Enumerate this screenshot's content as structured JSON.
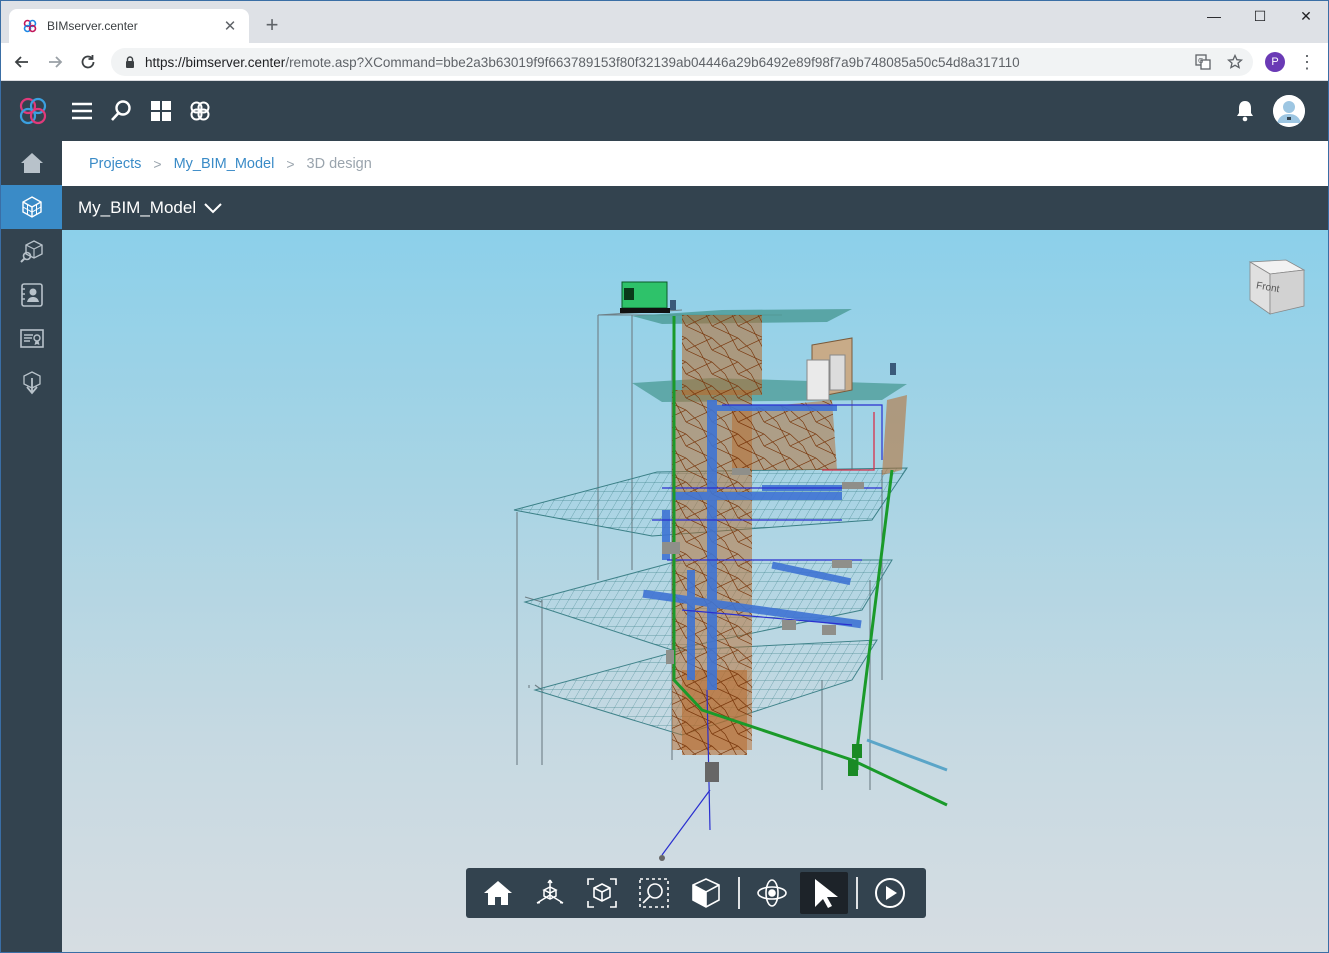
{
  "browser": {
    "tab_title": "BIMserver.center",
    "tab_close": "✕",
    "new_tab": "+",
    "url_host": "https://bimserver.center",
    "url_path": "/remote.asp?XCommand=bbe2a3b63019f9f663789153f80f32139ab04446a29b6492e89f98f7a9b748085a50c54d8a317110",
    "profile_initial": "P",
    "minimize": "—",
    "maximize": "☐",
    "close": "✕"
  },
  "header": {
    "icons": [
      "menu-icon",
      "search-icon",
      "grid-icon",
      "bimserver-icon"
    ],
    "right_icons": [
      "bell-icon",
      "avatar"
    ]
  },
  "sidebar": {
    "items": [
      {
        "icon": "home-icon",
        "active": false
      },
      {
        "icon": "3d-model-icon",
        "active": true
      },
      {
        "icon": "search-model-icon",
        "active": false
      },
      {
        "icon": "contacts-icon",
        "active": false
      },
      {
        "icon": "certificate-icon",
        "active": false
      },
      {
        "icon": "download-icon",
        "active": false
      }
    ]
  },
  "breadcrumb": {
    "items": [
      {
        "label": "Projects",
        "link": true
      },
      {
        "label": "My_BIM_Model",
        "link": true
      },
      {
        "label": "3D design",
        "link": false
      }
    ],
    "separator": ">"
  },
  "project": {
    "name": "My_BIM_Model"
  },
  "viewer": {
    "viewcube_label": "Front",
    "toolbar": [
      {
        "icon": "home-view-icon",
        "active": false
      },
      {
        "icon": "axes-icon",
        "active": false
      },
      {
        "icon": "fit-box-icon",
        "active": false
      },
      {
        "icon": "zoom-window-icon",
        "active": false
      },
      {
        "icon": "section-box-icon",
        "active": false
      },
      {
        "icon": "orbit-icon",
        "active": false
      },
      {
        "icon": "select-pointer-icon",
        "active": true
      },
      {
        "icon": "play-icon",
        "active": false
      }
    ]
  },
  "colors": {
    "header_bg": "#33434f",
    "accent": "#3a8bc7",
    "pipe_green": "#1a9a2a",
    "duct_blue": "#3f74d4",
    "shaft_brown": "#b86a2a"
  }
}
